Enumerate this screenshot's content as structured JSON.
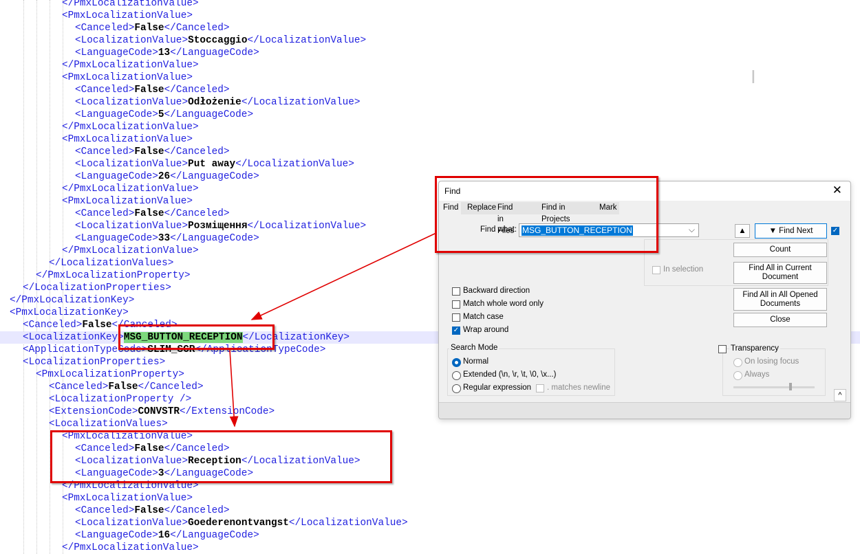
{
  "editor": {
    "lines": [
      {
        "indent": 4,
        "parts": [
          {
            "t": "tag",
            "s": "</PmxLocalizationValue>"
          }
        ]
      },
      {
        "indent": 4,
        "parts": [
          {
            "t": "tag",
            "s": "<PmxLocalizationValue>"
          }
        ]
      },
      {
        "indent": 5,
        "parts": [
          {
            "t": "tag",
            "s": "<Canceled>"
          },
          {
            "t": "val",
            "s": "False"
          },
          {
            "t": "tag",
            "s": "</Canceled>"
          }
        ]
      },
      {
        "indent": 5,
        "parts": [
          {
            "t": "tag",
            "s": "<LocalizationValue>"
          },
          {
            "t": "val",
            "s": "Stoccaggio"
          },
          {
            "t": "tag",
            "s": "</LocalizationValue>"
          }
        ]
      },
      {
        "indent": 5,
        "parts": [
          {
            "t": "tag",
            "s": "<LanguageCode>"
          },
          {
            "t": "val",
            "s": "13"
          },
          {
            "t": "tag",
            "s": "</LanguageCode>"
          }
        ]
      },
      {
        "indent": 4,
        "parts": [
          {
            "t": "tag",
            "s": "</PmxLocalizationValue>"
          }
        ]
      },
      {
        "indent": 4,
        "parts": [
          {
            "t": "tag",
            "s": "<PmxLocalizationValue>"
          }
        ]
      },
      {
        "indent": 5,
        "parts": [
          {
            "t": "tag",
            "s": "<Canceled>"
          },
          {
            "t": "val",
            "s": "False"
          },
          {
            "t": "tag",
            "s": "</Canceled>"
          }
        ]
      },
      {
        "indent": 5,
        "parts": [
          {
            "t": "tag",
            "s": "<LocalizationValue>"
          },
          {
            "t": "val",
            "s": "Odłożenie"
          },
          {
            "t": "tag",
            "s": "</LocalizationValue>"
          }
        ]
      },
      {
        "indent": 5,
        "parts": [
          {
            "t": "tag",
            "s": "<LanguageCode>"
          },
          {
            "t": "val",
            "s": "5"
          },
          {
            "t": "tag",
            "s": "</LanguageCode>"
          }
        ]
      },
      {
        "indent": 4,
        "parts": [
          {
            "t": "tag",
            "s": "</PmxLocalizationValue>"
          }
        ]
      },
      {
        "indent": 4,
        "parts": [
          {
            "t": "tag",
            "s": "<PmxLocalizationValue>"
          }
        ]
      },
      {
        "indent": 5,
        "parts": [
          {
            "t": "tag",
            "s": "<Canceled>"
          },
          {
            "t": "val",
            "s": "False"
          },
          {
            "t": "tag",
            "s": "</Canceled>"
          }
        ]
      },
      {
        "indent": 5,
        "parts": [
          {
            "t": "tag",
            "s": "<LocalizationValue>"
          },
          {
            "t": "val",
            "s": "Put away"
          },
          {
            "t": "tag",
            "s": "</LocalizationValue>"
          }
        ]
      },
      {
        "indent": 5,
        "parts": [
          {
            "t": "tag",
            "s": "<LanguageCode>"
          },
          {
            "t": "val",
            "s": "26"
          },
          {
            "t": "tag",
            "s": "</LanguageCode>"
          }
        ]
      },
      {
        "indent": 4,
        "parts": [
          {
            "t": "tag",
            "s": "</PmxLocalizationValue>"
          }
        ]
      },
      {
        "indent": 4,
        "parts": [
          {
            "t": "tag",
            "s": "<PmxLocalizationValue>"
          }
        ]
      },
      {
        "indent": 5,
        "parts": [
          {
            "t": "tag",
            "s": "<Canceled>"
          },
          {
            "t": "val",
            "s": "False"
          },
          {
            "t": "tag",
            "s": "</Canceled>"
          }
        ]
      },
      {
        "indent": 5,
        "parts": [
          {
            "t": "tag",
            "s": "<LocalizationValue>"
          },
          {
            "t": "val",
            "s": "Розміщення"
          },
          {
            "t": "tag",
            "s": "</LocalizationValue>"
          }
        ]
      },
      {
        "indent": 5,
        "parts": [
          {
            "t": "tag",
            "s": "<LanguageCode>"
          },
          {
            "t": "val",
            "s": "33"
          },
          {
            "t": "tag",
            "s": "</LanguageCode>"
          }
        ]
      },
      {
        "indent": 4,
        "parts": [
          {
            "t": "tag",
            "s": "</PmxLocalizationValue>"
          }
        ]
      },
      {
        "indent": 3,
        "parts": [
          {
            "t": "tag",
            "s": "</LocalizationValues>"
          }
        ]
      },
      {
        "indent": 2,
        "parts": [
          {
            "t": "tag",
            "s": "</PmxLocalizationProperty>"
          }
        ]
      },
      {
        "indent": 1,
        "parts": [
          {
            "t": "tag",
            "s": "</LocalizationProperties>"
          }
        ]
      },
      {
        "indent": 0,
        "parts": [
          {
            "t": "tag",
            "s": "</PmxLocalizationKey>"
          }
        ]
      },
      {
        "indent": 0,
        "parts": [
          {
            "t": "tag",
            "s": "<PmxLocalizationKey>"
          }
        ]
      },
      {
        "indent": 1,
        "parts": [
          {
            "t": "tag",
            "s": "<Canceled>"
          },
          {
            "t": "val",
            "s": "False"
          },
          {
            "t": "tag",
            "s": "</Canceled>"
          }
        ]
      },
      {
        "indent": 1,
        "highlight": true,
        "parts": [
          {
            "t": "tag",
            "s": "<LocalizationKey>"
          },
          {
            "t": "found",
            "s": "MSG_BUTTON_RECEPTION"
          },
          {
            "t": "tag",
            "s": "</LocalizationKey>"
          }
        ]
      },
      {
        "indent": 1,
        "parts": [
          {
            "t": "tag",
            "s": "<ApplicationTypeCode>"
          },
          {
            "t": "val",
            "s": "SLIM_SCR"
          },
          {
            "t": "tag",
            "s": "</ApplicationTypeCode>"
          }
        ]
      },
      {
        "indent": 1,
        "parts": [
          {
            "t": "tag",
            "s": "<LocalizationProperties>"
          }
        ]
      },
      {
        "indent": 2,
        "parts": [
          {
            "t": "tag",
            "s": "<PmxLocalizationProperty>"
          }
        ]
      },
      {
        "indent": 3,
        "parts": [
          {
            "t": "tag",
            "s": "<Canceled>"
          },
          {
            "t": "val",
            "s": "False"
          },
          {
            "t": "tag",
            "s": "</Canceled>"
          }
        ]
      },
      {
        "indent": 3,
        "parts": [
          {
            "t": "tag",
            "s": "<LocalizationProperty />"
          }
        ]
      },
      {
        "indent": 3,
        "parts": [
          {
            "t": "tag",
            "s": "<ExtensionCode>"
          },
          {
            "t": "val",
            "s": "CONVSTR"
          },
          {
            "t": "tag",
            "s": "</ExtensionCode>"
          }
        ]
      },
      {
        "indent": 3,
        "parts": [
          {
            "t": "tag",
            "s": "<LocalizationValues>"
          }
        ]
      },
      {
        "indent": 4,
        "parts": [
          {
            "t": "tag",
            "s": "<PmxLocalizationValue>"
          }
        ]
      },
      {
        "indent": 5,
        "parts": [
          {
            "t": "tag",
            "s": "<Canceled>"
          },
          {
            "t": "val",
            "s": "False"
          },
          {
            "t": "tag",
            "s": "</Canceled>"
          }
        ]
      },
      {
        "indent": 5,
        "parts": [
          {
            "t": "tag",
            "s": "<LocalizationValue>"
          },
          {
            "t": "val",
            "s": "Reception"
          },
          {
            "t": "tag",
            "s": "</LocalizationValue>"
          }
        ]
      },
      {
        "indent": 5,
        "parts": [
          {
            "t": "tag",
            "s": "<LanguageCode>"
          },
          {
            "t": "val",
            "s": "3"
          },
          {
            "t": "tag",
            "s": "</LanguageCode>"
          }
        ]
      },
      {
        "indent": 4,
        "parts": [
          {
            "t": "tag",
            "s": "</PmxLocalizationValue>"
          }
        ]
      },
      {
        "indent": 4,
        "parts": [
          {
            "t": "tag",
            "s": "<PmxLocalizationValue>"
          }
        ]
      },
      {
        "indent": 5,
        "parts": [
          {
            "t": "tag",
            "s": "<Canceled>"
          },
          {
            "t": "val",
            "s": "False"
          },
          {
            "t": "tag",
            "s": "</Canceled>"
          }
        ]
      },
      {
        "indent": 5,
        "parts": [
          {
            "t": "tag",
            "s": "<LocalizationValue>"
          },
          {
            "t": "val",
            "s": "Goederenontvangst"
          },
          {
            "t": "tag",
            "s": "</LocalizationValue>"
          }
        ]
      },
      {
        "indent": 5,
        "parts": [
          {
            "t": "tag",
            "s": "<LanguageCode>"
          },
          {
            "t": "val",
            "s": "16"
          },
          {
            "t": "tag",
            "s": "</LanguageCode>"
          }
        ]
      },
      {
        "indent": 4,
        "parts": [
          {
            "t": "tag",
            "s": "</PmxLocalizationValue>"
          }
        ]
      }
    ]
  },
  "find_dialog": {
    "title": "Find",
    "tabs": [
      "Find",
      "Replace",
      "Find in Files",
      "Find in Projects",
      "Mark"
    ],
    "active_tab": "Find",
    "find_what_label": "Find what:",
    "find_what_value": "MSG_BUTTON_RECEPTION",
    "buttons": {
      "prev": "▲",
      "find_next": "▼ Find Next",
      "count": "Count",
      "find_all_current": "Find All in Current Document",
      "find_all_opened": "Find All in All Opened Documents",
      "close": "Close"
    },
    "in_selection": "In selection",
    "options": {
      "backward": {
        "label": "Backward direction",
        "checked": false
      },
      "whole_word": {
        "label": "Match whole word only",
        "checked": false
      },
      "match_case": {
        "label": "Match case",
        "checked": false
      },
      "wrap_around": {
        "label": "Wrap around",
        "checked": true
      }
    },
    "search_mode": {
      "title": "Search Mode",
      "normal": "Normal",
      "extended": "Extended (\\n, \\r, \\t, \\0, \\x...)",
      "regex": "Regular expression",
      "matches_newline": ". matches newline",
      "selected": "Normal"
    },
    "transparency": {
      "label": "Transparency",
      "on_losing_focus": "On losing focus",
      "always": "Always"
    },
    "resize_glyph": "^"
  },
  "colors": {
    "tag": "#1f1fdf",
    "value": "#000000",
    "found_highlight": "#7dd87d",
    "current_line": "#e8e8ff",
    "annotation": "#e00000"
  }
}
